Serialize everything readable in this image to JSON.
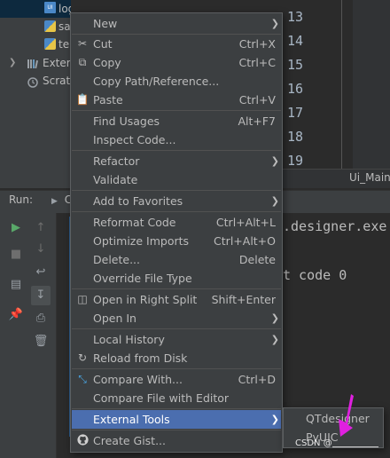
{
  "tree": {
    "items": [
      {
        "label": "login.ui",
        "icon": "ui-file-icon"
      },
      {
        "label": "sa",
        "icon": "python-file-icon"
      },
      {
        "label": "te",
        "icon": "python-file-icon"
      },
      {
        "label": "Exter",
        "icon": "libraries-icon"
      },
      {
        "label": "Scrat",
        "icon": "scratches-icon"
      }
    ]
  },
  "editor": {
    "line_numbers": [
      "13",
      "14",
      "15",
      "16",
      "17",
      "18",
      "19"
    ],
    "breadcrumb": "Ui_Main"
  },
  "run": {
    "label": "Run:",
    "tab_label": "C",
    "console_lines": [
      ".designer.exe",
      "t code 0"
    ]
  },
  "menu": {
    "items": [
      {
        "label": "New",
        "shortcut": "",
        "submenu": true,
        "icon": ""
      },
      {
        "label": "Cut",
        "shortcut": "Ctrl+X",
        "submenu": false,
        "icon": "cut-icon"
      },
      {
        "label": "Copy",
        "shortcut": "Ctrl+C",
        "submenu": false,
        "icon": "copy-icon"
      },
      {
        "label": "Copy Path/Reference...",
        "shortcut": "",
        "submenu": false,
        "icon": ""
      },
      {
        "label": "Paste",
        "shortcut": "Ctrl+V",
        "submenu": false,
        "icon": "paste-icon"
      },
      {
        "label": "Find Usages",
        "shortcut": "Alt+F7",
        "submenu": false,
        "icon": ""
      },
      {
        "label": "Inspect Code...",
        "shortcut": "",
        "submenu": false,
        "icon": ""
      },
      {
        "label": "Refactor",
        "shortcut": "",
        "submenu": true,
        "icon": ""
      },
      {
        "label": "Validate",
        "shortcut": "",
        "submenu": false,
        "icon": ""
      },
      {
        "label": "Add to Favorites",
        "shortcut": "",
        "submenu": true,
        "icon": ""
      },
      {
        "label": "Reformat Code",
        "shortcut": "Ctrl+Alt+L",
        "submenu": false,
        "icon": ""
      },
      {
        "label": "Optimize Imports",
        "shortcut": "Ctrl+Alt+O",
        "submenu": false,
        "icon": ""
      },
      {
        "label": "Delete...",
        "shortcut": "Delete",
        "submenu": false,
        "icon": ""
      },
      {
        "label": "Override File Type",
        "shortcut": "",
        "submenu": false,
        "icon": ""
      },
      {
        "label": "Open in Right Split",
        "shortcut": "Shift+Enter",
        "submenu": false,
        "icon": "split-icon"
      },
      {
        "label": "Open In",
        "shortcut": "",
        "submenu": true,
        "icon": ""
      },
      {
        "label": "Local History",
        "shortcut": "",
        "submenu": true,
        "icon": ""
      },
      {
        "label": "Reload from Disk",
        "shortcut": "",
        "submenu": false,
        "icon": "reload-icon"
      },
      {
        "label": "Compare With...",
        "shortcut": "Ctrl+D",
        "submenu": false,
        "icon": "compare-icon"
      },
      {
        "label": "Compare File with Editor",
        "shortcut": "",
        "submenu": false,
        "icon": ""
      },
      {
        "label": "External Tools",
        "shortcut": "",
        "submenu": true,
        "icon": "",
        "highlighted": true
      },
      {
        "label": "Create Gist...",
        "shortcut": "",
        "submenu": false,
        "icon": "github-icon"
      }
    ]
  },
  "submenu": {
    "items": [
      {
        "label": "QTdesigner"
      },
      {
        "label": "PyUIC"
      }
    ]
  },
  "watermark": "CSDN @",
  "colors": {
    "menu_bg": "#3c3f41",
    "highlight": "#4b6eaf",
    "arrow": "#e020e0"
  }
}
